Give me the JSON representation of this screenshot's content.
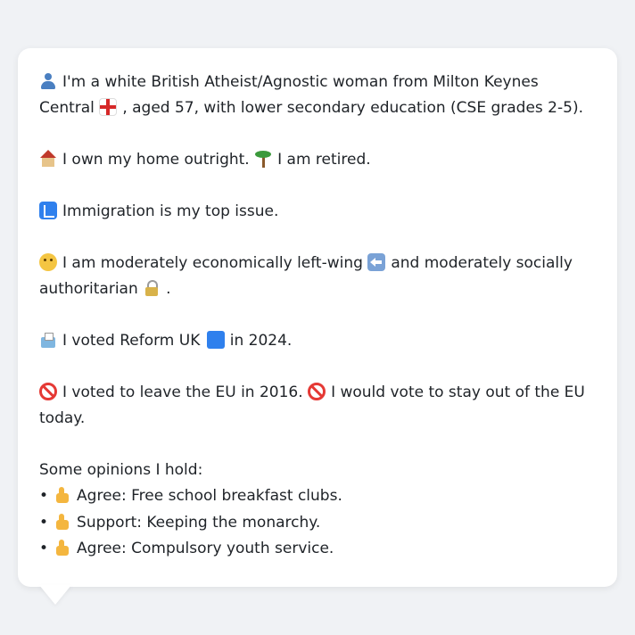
{
  "profile": {
    "intro_text": "I'm a white British Atheist/Agnostic woman from Milton Keynes Central",
    "intro_tail": ", aged 57, with lower secondary education (CSE grades 2-5).",
    "home_text": "I own my home outright.",
    "retired_text": "I am retired.",
    "top_issue_text": "Immigration is my top issue.",
    "politics_text_1": "I am moderately economically left-wing",
    "politics_text_2": "and moderately socially authoritarian",
    "politics_end": ".",
    "vote_text_1": "I voted Reform UK",
    "vote_text_2": "in 2024.",
    "eu_text_1": "I voted to leave the EU in 2016.",
    "eu_text_2": "I would vote to stay out of the EU today.",
    "opinions_heading": "Some opinions I hold:",
    "opinions": [
      {
        "bullet": "•",
        "text": "Agree: Free school breakfast clubs."
      },
      {
        "bullet": "•",
        "text": "Support: Keeping the monarchy."
      },
      {
        "bullet": "•",
        "text": "Agree: Compulsory youth service."
      }
    ]
  },
  "icons": {
    "person": "person-icon",
    "flag": "england-flag-icon",
    "home": "house-icon",
    "retired": "palm-tree-icon",
    "issue": "passport-control-icon",
    "thinking": "thinking-face-icon",
    "left": "left-arrow-icon",
    "lock": "lock-icon",
    "ballot": "ballot-box-icon",
    "party": "blue-square-icon",
    "no_entry": "no-entry-icon",
    "thumbs_up": "thumbs-up-icon"
  },
  "colors": {
    "background": "#f0f2f5",
    "card": "#ffffff",
    "text": "#1f2328"
  }
}
